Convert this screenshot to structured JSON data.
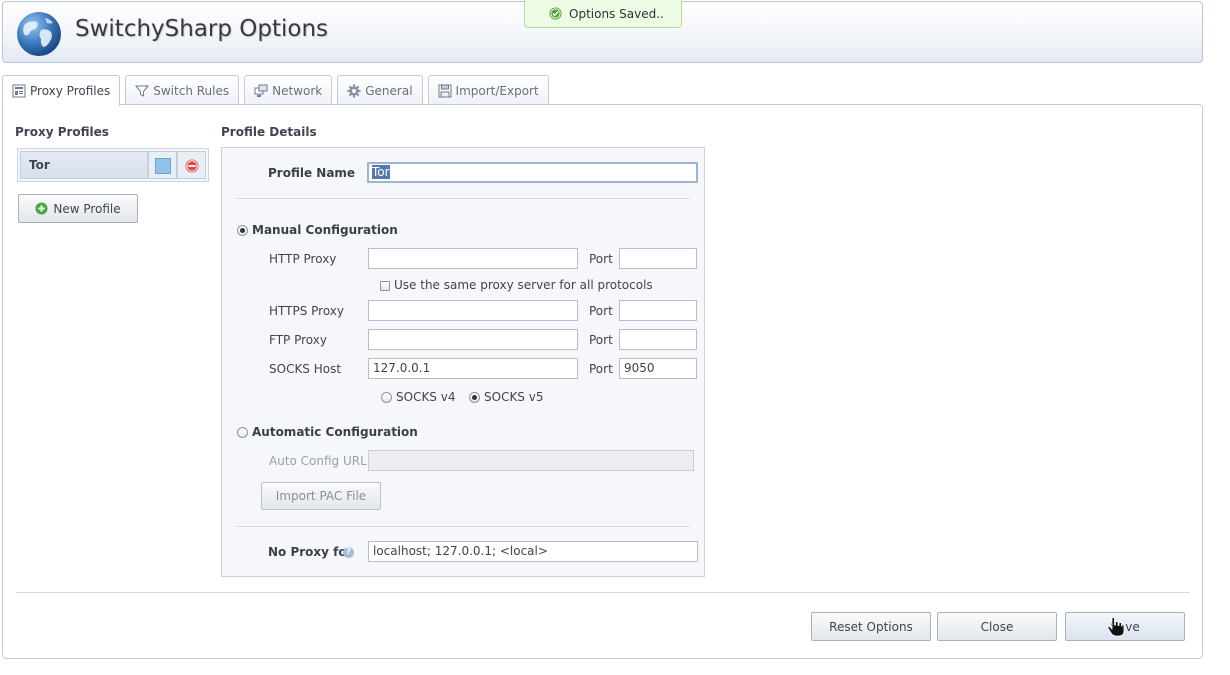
{
  "header": {
    "title": "SwitchySharp Options"
  },
  "toast": {
    "message": "Options Saved.."
  },
  "tabs": [
    {
      "label": "Proxy Profiles",
      "icon": "profiles-icon",
      "active": true
    },
    {
      "label": "Switch Rules",
      "icon": "filter-icon",
      "active": false
    },
    {
      "label": "Network",
      "icon": "network-icon",
      "active": false
    },
    {
      "label": "General",
      "icon": "gear-icon",
      "active": false
    },
    {
      "label": "Import/Export",
      "icon": "disk-icon",
      "active": false
    }
  ],
  "profiles": {
    "title": "Proxy Profiles",
    "items": [
      {
        "name": "Tor",
        "color": "#8fc3ec"
      }
    ],
    "new_button": "New Profile"
  },
  "details": {
    "title": "Profile Details",
    "profile_name_label": "Profile Name",
    "profile_name_value": "Tor",
    "manual": {
      "label": "Manual Configuration",
      "selected": true,
      "http_label": "HTTP Proxy",
      "http_value": "",
      "http_port": "",
      "same_proxy_label": "Use the same proxy server for all protocols",
      "same_proxy_checked": false,
      "https_label": "HTTPS Proxy",
      "https_value": "",
      "https_port": "",
      "ftp_label": "FTP Proxy",
      "ftp_value": "",
      "ftp_port": "",
      "socks_label": "SOCKS Host",
      "socks_value": "127.0.0.1",
      "socks_port": "9050",
      "port_label": "Port",
      "socks_v4_label": "SOCKS v4",
      "socks_v5_label": "SOCKS v5",
      "socks_version": "v5"
    },
    "automatic": {
      "label": "Automatic Configuration",
      "selected": false,
      "url_label": "Auto Config URL",
      "url_value": "",
      "import_button": "Import PAC File"
    },
    "no_proxy_label": "No Proxy for",
    "no_proxy_value": "localhost; 127.0.0.1; <local>"
  },
  "footer": {
    "reset": "Reset Options",
    "close": "Close",
    "save": "Save"
  }
}
